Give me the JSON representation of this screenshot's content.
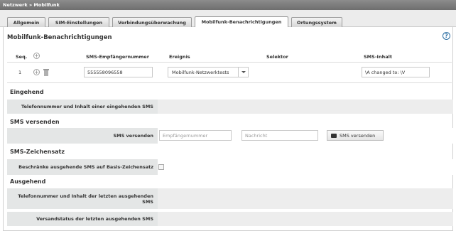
{
  "breadcrumb": "Netzwerk » Mobilfunk",
  "tabs": [
    {
      "label": "Allgemein",
      "active": false
    },
    {
      "label": "SIM-Einstellungen",
      "active": false
    },
    {
      "label": "Verbindungsüberwachung",
      "active": false
    },
    {
      "label": "Mobilfunk-Benachrichtigungen",
      "active": true
    },
    {
      "label": "Ortungssystem",
      "active": false
    }
  ],
  "panel": {
    "title": "Mobilfunk-Benachrichtigungen",
    "help_icon": "?"
  },
  "table": {
    "headers": {
      "seq": "Seq.",
      "sms_recipient": "SMS-Empfängernummer",
      "event": "Ereignis",
      "selector": "Selektor",
      "sms_content": "SMS-Inhalt"
    },
    "rows": [
      {
        "seq": "1",
        "recipient": "555558096558",
        "event": "Mobilfunk-Netzwerktests",
        "selector": "",
        "content": "\\A changed to: \\V"
      }
    ]
  },
  "incoming": {
    "title": "Eingehend",
    "label": "Telefonnummer und Inhalt einer eingehenden SMS"
  },
  "send": {
    "title": "SMS versenden",
    "label": "SMS versenden",
    "recipient_placeholder": "Empfängernummer",
    "message_placeholder": "Nachricht",
    "button_label": "SMS versenden"
  },
  "charset": {
    "title": "SMS-Zeichensatz",
    "label": "Beschränke ausgehende SMS auf Basis-Zeichensatz",
    "checked": false
  },
  "outgoing": {
    "title": "Ausgehend",
    "last_label": "Telefonnummer und Inhalt der letzten ausgehenden SMS",
    "status_label": "Versandstatus der letzten ausgehenden SMS"
  },
  "colors": {
    "accent": "#2b6ea3",
    "row_label_bg": "#e4e6e6",
    "row_value_bg": "#ededed"
  }
}
